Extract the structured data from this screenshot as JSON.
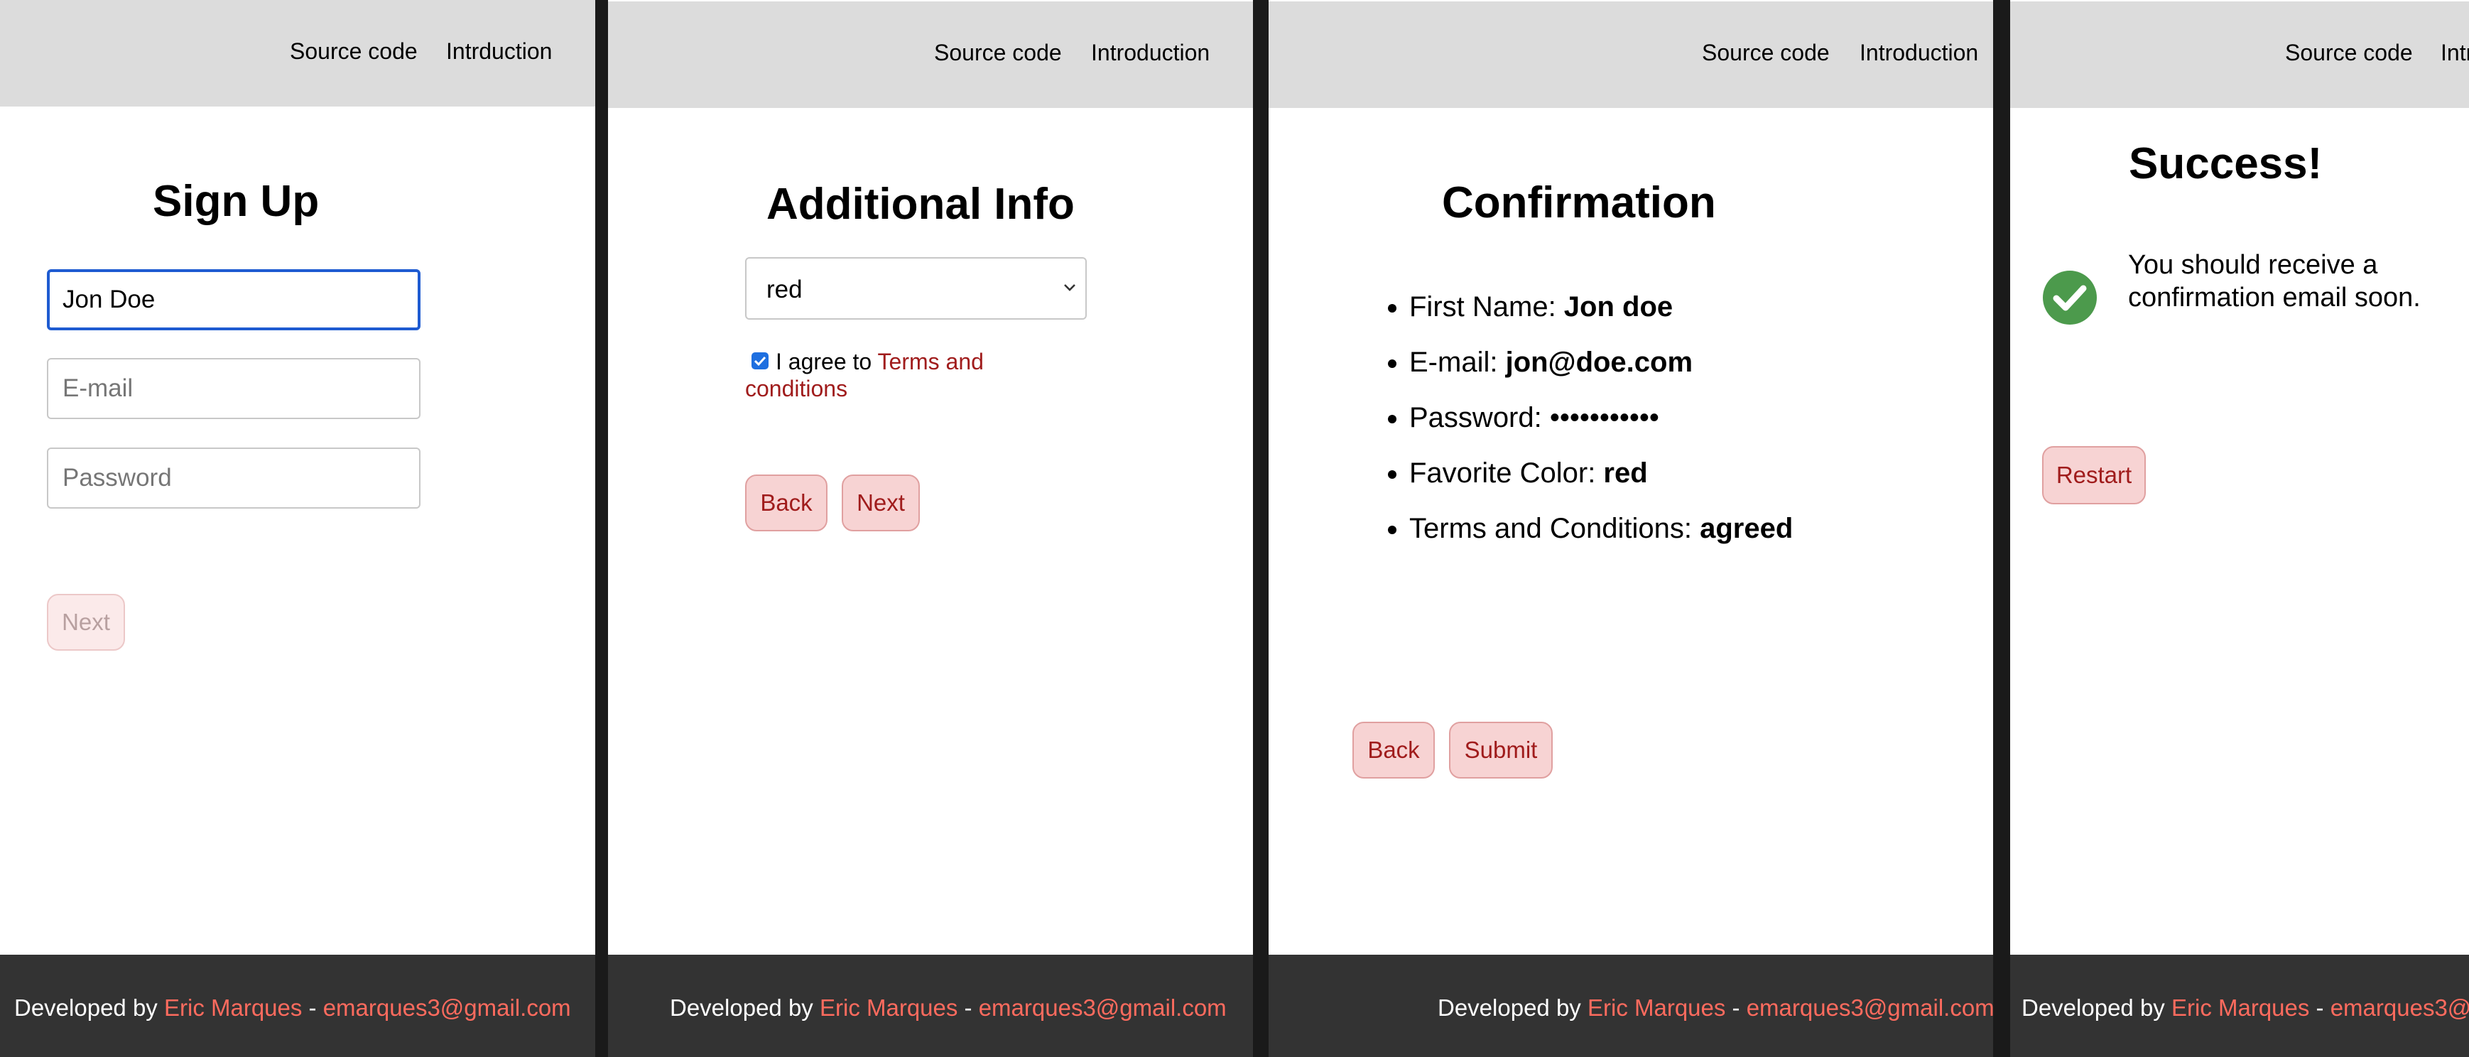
{
  "nav": {
    "source_code": "Source code",
    "intro_misspelled": "Intrduction",
    "intro": "Introduction"
  },
  "footer": {
    "prefix": "Developed by ",
    "author": "Eric Marques",
    "separator": " - ",
    "email": "emarques3@gmail.com"
  },
  "signup": {
    "title": "Sign Up",
    "name_value": "Jon Doe",
    "email_placeholder": "E-mail",
    "password_placeholder": "Password",
    "next_label": "Next"
  },
  "additional": {
    "title": "Additional Info",
    "color_options": [
      "red"
    ],
    "color_selected": "red",
    "agree_text": "I agree to ",
    "terms_link": "Terms and conditions",
    "back_label": "Back",
    "next_label": "Next"
  },
  "confirmation": {
    "title": "Confirmation",
    "items": [
      {
        "label": "First Name: ",
        "value": "Jon doe"
      },
      {
        "label": "E-mail: ",
        "value": "jon@doe.com"
      },
      {
        "label": "Password: ",
        "value": "•••••••••••"
      },
      {
        "label": "Favorite Color: ",
        "value": "red"
      },
      {
        "label": "Terms and Conditions: ",
        "value": "agreed"
      }
    ],
    "back_label": "Back",
    "submit_label": "Submit"
  },
  "success": {
    "title": "Success!",
    "message": "You should receive a confirmation email soon.",
    "restart_label": "Restart"
  },
  "colors": {
    "accent_text": "#a01c1c",
    "button_bg": "#f7d3d3",
    "footer_bg": "#333333",
    "check_green": "#4c9a4c",
    "focus_blue": "#1e5bd1"
  }
}
